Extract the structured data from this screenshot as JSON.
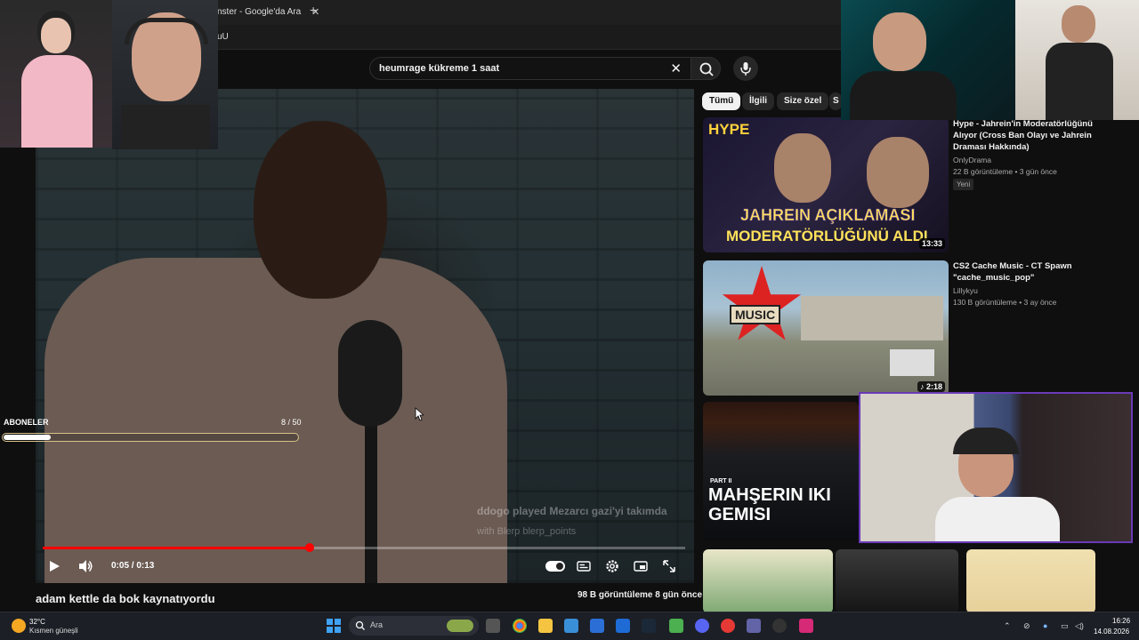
{
  "browser": {
    "tab_title": "nster - Google'da Ara",
    "tab_close": "✕",
    "new_tab": "+",
    "url": "uU"
  },
  "search": {
    "query": "heumrage kükreme 1 saat",
    "clear": "✕"
  },
  "player": {
    "overlay_line1": "ddogo played Mezarcı gazi'yi takımda",
    "overlay_line2": "with Blerp blerp_points",
    "current_time": "0:05 / 0:13",
    "progress": 0.415
  },
  "subscriber_goal": {
    "label": "ABONELER",
    "count": "8 / 50",
    "progress": 0.16
  },
  "video": {
    "title": "adam kettle da bok kaynatıyordu",
    "meta": "98 B görüntüleme  8 gün önce"
  },
  "chips": [
    "Tümü",
    "İlgili",
    "Size özel",
    "S"
  ],
  "recommendations": [
    {
      "title": "Hype - Jahrein'in Moderatörlüğünü Alıyor (Cross Ban Olayı ve Jahrein Draması Hakkında)",
      "channel": "OnlyDrama",
      "stats": "22 B görüntüleme • 3 gün önce",
      "badge": "Yeni",
      "duration": "13:33",
      "thumb_brand": "HYPE",
      "thumb_line1": "JAHREIN AÇIKLAMASI",
      "thumb_line2": "MODERATÖRLÜĞÜNÜ ALDI"
    },
    {
      "title": "CS2 Cache Music - CT Spawn \"cache_music_pop\"",
      "channel": "Lillykyu",
      "stats": "130 B görüntüleme • 3 ay önce",
      "duration": "♪ 2:18",
      "thumb_label": "MUSIC"
    },
    {
      "thumb_part": "PART II",
      "thumb_line1": "MAHŞERIN IKI",
      "thumb_line2": "GEMISI"
    }
  ],
  "taskbar": {
    "temperature": "32°C",
    "weather": "Kısmen güneşli",
    "search_placeholder": "Ara",
    "time": "16:26",
    "date": "14.08.2026"
  }
}
